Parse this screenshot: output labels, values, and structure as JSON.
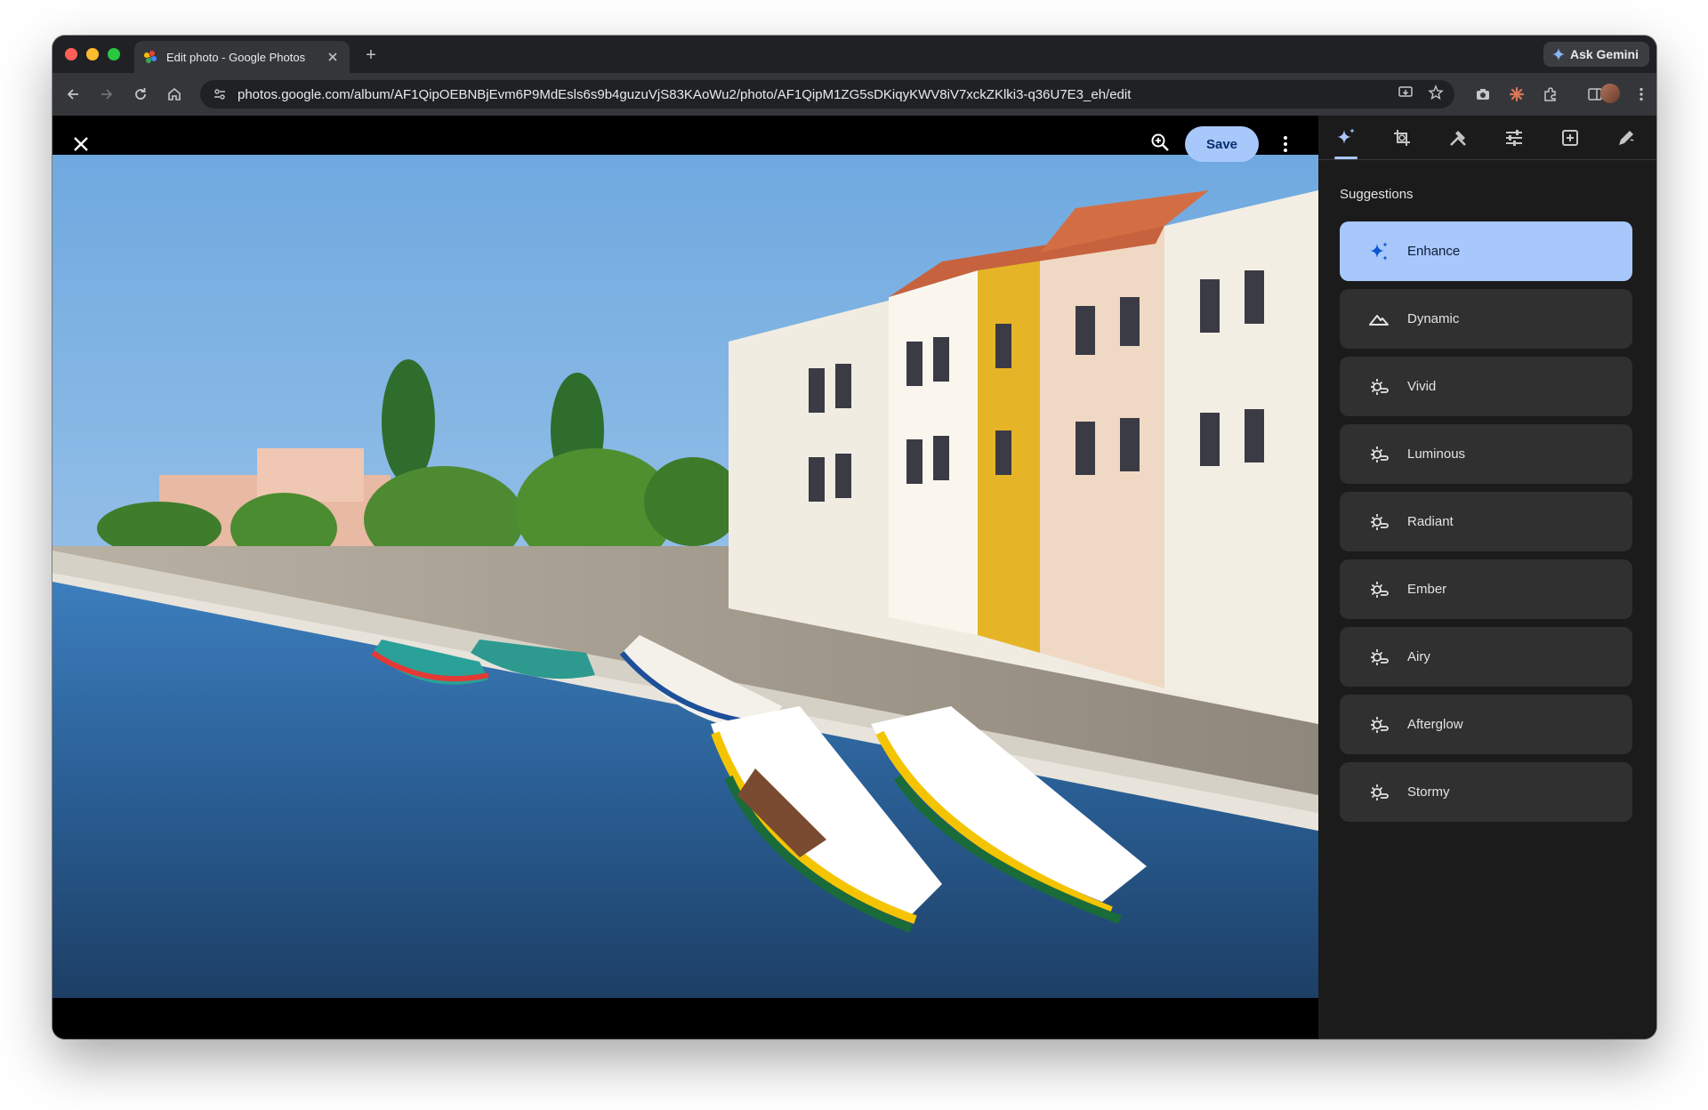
{
  "browser": {
    "tab_title": "Edit photo - Google Photos",
    "new_tab_label": "+",
    "ask_gemini_label": "Ask Gemini",
    "url": "photos.google.com/album/AF1QipOEBNBjEvm6P9MdEsls6s9b4guzuVjS83KAoWu2/photo/AF1QipM1ZG5sDKiqyKWV8iV7xckZKlki3-q36U7E3_eh/edit"
  },
  "editor": {
    "save_label": "Save",
    "photo_description_icon": "photo-canvas"
  },
  "panel": {
    "tabs": [
      {
        "name": "suggestions",
        "icon": "sparkle-icon",
        "active": true
      },
      {
        "name": "crop",
        "icon": "crop-rotate-icon",
        "active": false
      },
      {
        "name": "tools",
        "icon": "tools-icon",
        "active": false
      },
      {
        "name": "adjust",
        "icon": "sliders-icon",
        "active": false
      },
      {
        "name": "filters",
        "icon": "filter-icon",
        "active": false
      },
      {
        "name": "markup",
        "icon": "markup-icon",
        "active": false
      }
    ],
    "section_title": "Suggestions",
    "suggestions": [
      {
        "label": "Enhance",
        "icon": "sparkle-icon",
        "selected": true
      },
      {
        "label": "Dynamic",
        "icon": "mountain-icon",
        "selected": false
      },
      {
        "label": "Vivid",
        "icon": "sun-cloud-icon",
        "selected": false
      },
      {
        "label": "Luminous",
        "icon": "sun-cloud-icon",
        "selected": false
      },
      {
        "label": "Radiant",
        "icon": "sun-cloud-icon",
        "selected": false
      },
      {
        "label": "Ember",
        "icon": "sun-cloud-icon",
        "selected": false
      },
      {
        "label": "Airy",
        "icon": "sun-cloud-icon",
        "selected": false
      },
      {
        "label": "Afterglow",
        "icon": "sun-cloud-icon",
        "selected": false
      },
      {
        "label": "Stormy",
        "icon": "sun-cloud-icon",
        "selected": false
      }
    ]
  },
  "colors": {
    "accent": "#a8c7fa",
    "panel_bg": "#1b1b1b",
    "card_bg": "#303030"
  }
}
